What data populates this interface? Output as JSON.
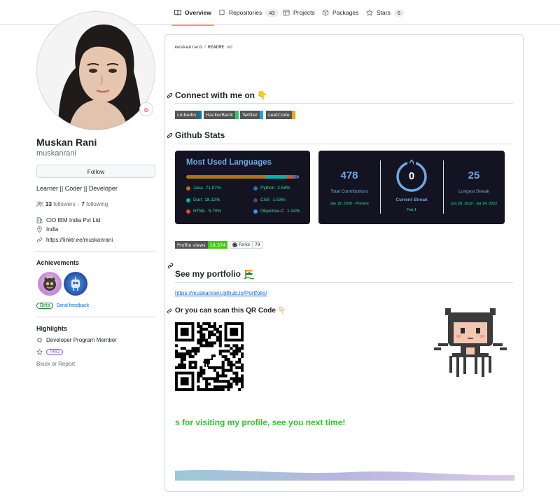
{
  "tabs": [
    {
      "label": "Overview",
      "icon": "book-icon",
      "active": true
    },
    {
      "label": "Repositories",
      "icon": "repo-icon",
      "count": "43"
    },
    {
      "label": "Projects",
      "icon": "table-icon"
    },
    {
      "label": "Packages",
      "icon": "package-icon"
    },
    {
      "label": "Stars",
      "icon": "star-icon",
      "count": "6"
    }
  ],
  "profile": {
    "name": "Muskan Rani",
    "login": "muskanrani",
    "follow_label": "Follow",
    "bio": "Learner || Coder || Developer",
    "followers_count": "33",
    "followers_label": "followers",
    "dot": "·",
    "following_count": "7",
    "following_label": "following",
    "company": "CIO IBM India Pvt Ltd",
    "location": "India",
    "website": "https://linktr.ee/muskanrani"
  },
  "achievements": {
    "title": "Achievements",
    "beta_label": "Beta",
    "feedback_label": "Send feedback"
  },
  "highlights": {
    "title": "Highlights",
    "program": "Developer Program Member",
    "pro_label": "PRO",
    "block_label": "Block or Report"
  },
  "readme": {
    "owner": "muskanrani",
    "sep": "/",
    "file": "README",
    "ext": ".md",
    "connect_heading": "Connect with me on 👇",
    "social_badges": [
      {
        "label": "LinkedIn",
        "color": "#0077b5"
      },
      {
        "label": "HackerRank",
        "color": "#2ec866"
      },
      {
        "label": "Twitter",
        "color": "#1da1f2"
      },
      {
        "label": "LeetCode",
        "color": "#ffa116"
      }
    ],
    "stats_heading": "Github Stats",
    "portfolio_heading": "See my portfolio",
    "portfolio_url": "https://muskanrani.github.io/Portfolio/",
    "qr_heading": "Or you can scan this QR Code 👇🏻",
    "thanks_text": "s for visiting my profile, see you next time!"
  },
  "languages_card": {
    "title": "Most Used Languages",
    "languages": [
      {
        "name": "Java",
        "pct": "71.07%",
        "color": "#b07219"
      },
      {
        "name": "Python",
        "pct": "2.54%",
        "color": "#3572a5"
      },
      {
        "name": "Dart",
        "pct": "18.12%",
        "color": "#00b4ab"
      },
      {
        "name": "CSS",
        "pct": "1.53%",
        "color": "#563d7c"
      },
      {
        "name": "HTML",
        "pct": "5.70%",
        "color": "#e34c26"
      },
      {
        "name": "Objective-C",
        "pct": "1.04%",
        "color": "#438eff"
      }
    ]
  },
  "streak_card": {
    "total": "478",
    "total_label": "Total Contributions",
    "total_range": "Jan 19, 2020 - Present",
    "current": "0",
    "current_label": "Current Streak",
    "current_range": "Feb 1",
    "longest": "25",
    "longest_label": "Longest Streak",
    "longest_range": "Jun 20, 2022 - Jul 14, 2022"
  },
  "counters": {
    "views_label": "Profile views",
    "views_value": "18,374",
    "forks_label": "Forks",
    "forks_value": "79"
  },
  "colors": {
    "accent_tab": "#fd8c73",
    "link": "#0969da",
    "card_bg": "#141321",
    "card_title": "#6ea8e6",
    "card_text": "#2fe09e",
    "thanks_green": "#2ec62e"
  }
}
